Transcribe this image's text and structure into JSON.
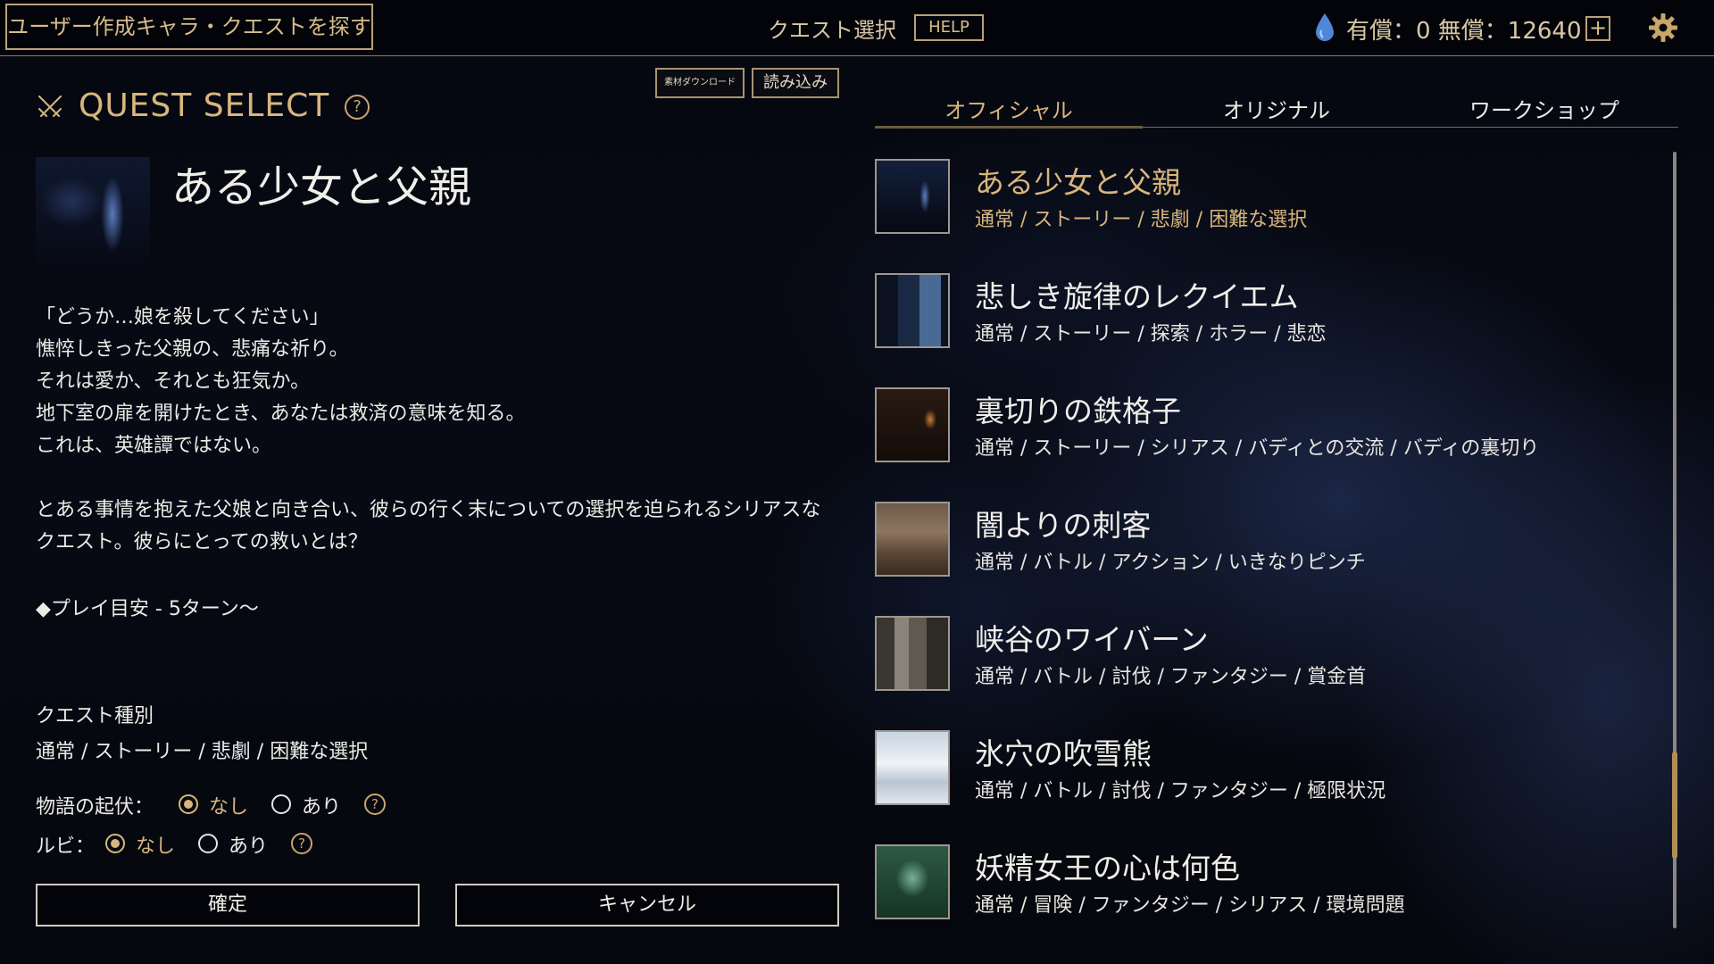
{
  "topbar": {
    "search_user_button": "ユーザー作成キャラ・クエストを探す",
    "title": "クエスト選択",
    "help_button": "HELP",
    "currency_text": "有償：0 無償：12640",
    "plus_button": "+",
    "icons": {
      "currency": "water-drop-icon",
      "settings": "gear-icon"
    }
  },
  "left": {
    "header": "QUEST SELECT",
    "header_help": "?",
    "download_button": "素材ダウンロード",
    "load_button": "読み込み",
    "quest_title": "ある少女と父親",
    "description_lines": "「どうか…娘を殺してください」\n憔悴しきった父親の、悲痛な祈り。\nそれは愛か、それとも狂気か。\n地下室の扉を開けたとき、あなたは救済の意味を知る。\nこれは、英雄譚ではない。",
    "description_2": "とある事情を抱えた父娘と向き合い、彼らの行く末についての選択を迫られるシリアスなクエスト。彼らにとっての救いとは？",
    "play_time": "◆プレイ目安 - 5ターン～",
    "quest_type_label": "クエスト種別",
    "quest_type_value": "通常 / ストーリー / 悲劇 / 困難な選択",
    "story_option": {
      "label": "物語の起伏：",
      "opt_none": "なし",
      "opt_yes": "あり",
      "selected": "なし",
      "help": "?"
    },
    "ruby_option": {
      "label": "ルビ：",
      "opt_none": "なし",
      "opt_yes": "あり",
      "selected": "なし",
      "help": "?"
    },
    "confirm_button": "確定",
    "cancel_button": "キャンセル"
  },
  "tabs": [
    {
      "label": "オフィシャル",
      "active": true
    },
    {
      "label": "オリジナル",
      "active": false
    },
    {
      "label": "ワークショップ",
      "active": false
    }
  ],
  "quests": [
    {
      "title": "ある少女と父親",
      "tags": "通常 / ストーリー / 悲劇 / 困難な選択",
      "selected": true
    },
    {
      "title": "悲しき旋律のレクイエム",
      "tags": "通常 / ストーリー / 探索 / ホラー / 悲恋",
      "selected": false
    },
    {
      "title": "裏切りの鉄格子",
      "tags": "通常 / ストーリー / シリアス / バディとの交流 / バディの裏切り",
      "selected": false
    },
    {
      "title": "闇よりの刺客",
      "tags": "通常 / バトル / アクション / いきなりピンチ",
      "selected": false
    },
    {
      "title": "峡谷のワイバーン",
      "tags": "通常 / バトル / 討伐 / ファンタジー / 賞金首",
      "selected": false
    },
    {
      "title": "氷穴の吹雪熊",
      "tags": "通常 / バトル / 討伐 / ファンタジー / 極限状況",
      "selected": false
    },
    {
      "title": "妖精女王の心は何色",
      "tags": "通常 / 冒険 / ファンタジー / シリアス / 環境問題",
      "selected": false
    }
  ],
  "colors": {
    "accent": "#d8b67c",
    "text": "#ecebe6",
    "background": "#05070d"
  }
}
